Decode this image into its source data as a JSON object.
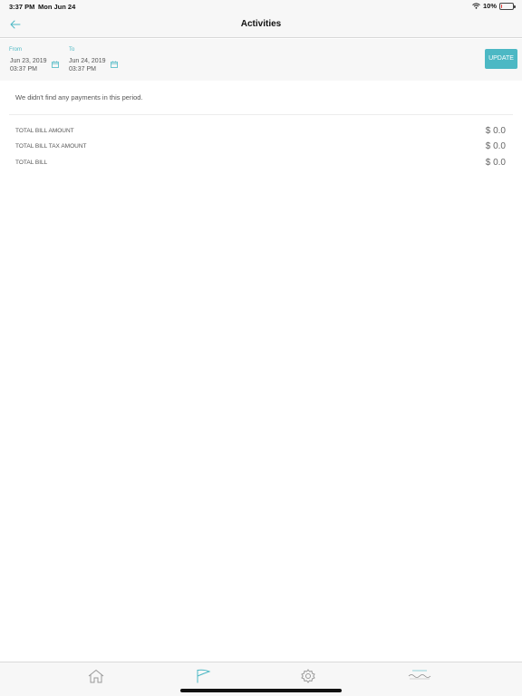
{
  "status_bar": {
    "time": "3:37 PM",
    "date": "Mon Jun 24",
    "battery": "10%",
    "battery_level": 0.1,
    "icons": [
      "wifi-icon",
      "battery-icon"
    ]
  },
  "nav": {
    "title": "Activities",
    "back_icon": "back-arrow-icon"
  },
  "period": {
    "from_label": "From",
    "from_date": "Jun 23, 2019",
    "from_time": "03:37 PM",
    "to_label": "To",
    "to_date": "Jun 24, 2019",
    "to_time": "03:37 PM",
    "calendar_icon": "calendar-icon",
    "update_label": "UPDATE"
  },
  "message": "We didn't find any payments in this period.",
  "totals": [
    {
      "label": "TOTAL BILL AMOUNT",
      "value": "$ 0.0"
    },
    {
      "label": "TOTAL BILL TAX AMOUNT",
      "value": "$ 0.0"
    },
    {
      "label": "TOTAL BILL",
      "value": "$ 0.0"
    }
  ],
  "tab_bar": {
    "tabs": [
      "home-icon",
      "flag-icon",
      "settings-icon"
    ],
    "active_tab": "flag-icon"
  },
  "colors": {
    "accent": "#4cb8c4",
    "background": "#ffffff",
    "bar_background": "#f7f7f7",
    "battery_low": "#e53935"
  }
}
